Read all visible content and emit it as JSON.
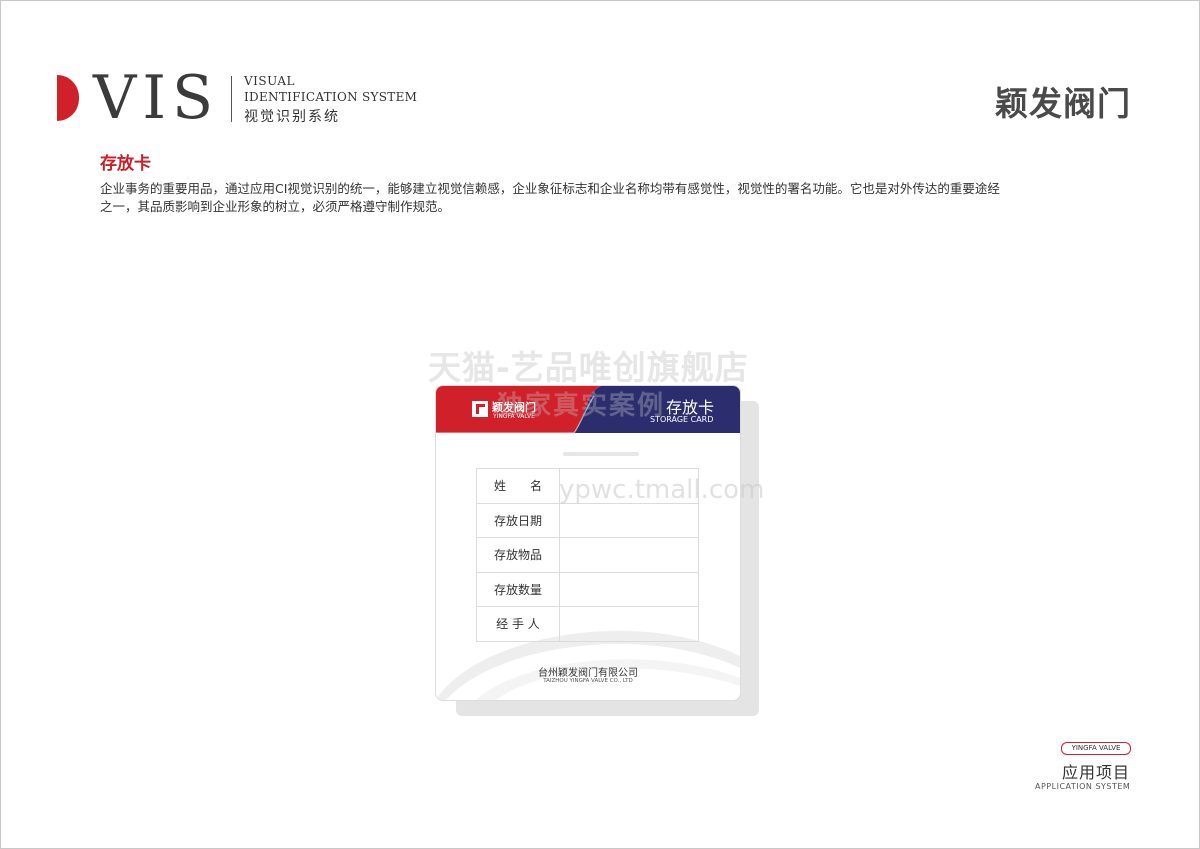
{
  "header": {
    "vis_word": "VIS",
    "line1": "VISUAL",
    "line2": "IDENTIFICATION SYSTEM",
    "line3": "视觉识别系统",
    "brand_right": "颖发阀门"
  },
  "section": {
    "title": "存放卡",
    "description": "企业事务的重要用品，通过应用CI视觉识别的统一，能够建立视觉信赖感，企业象征标志和企业名称均带有感觉性，视觉性的署名功能。它也是对外传达的重要途经之一，其品质影响到企业形象的树立，必须严格遵守制作规范。"
  },
  "watermark": {
    "line1": "天猫-艺品唯创旗舰店",
    "line2": "独家真实案例",
    "line3": "ypwc.tmall.com"
  },
  "card": {
    "logo_cn": "颖发阀门",
    "logo_en": "YINGFA VALVE",
    "title_cn": "存放卡",
    "title_en": "STORAGE CARD",
    "rows": [
      {
        "label": "姓　　名"
      },
      {
        "label": "存放日期"
      },
      {
        "label": "存放物品"
      },
      {
        "label": "存放数量"
      },
      {
        "label": "经 手 人"
      }
    ],
    "company_cn": "台州颖发阀门有限公司",
    "company_en": "TAIZHOU YINGFA VALVE CO., LTD",
    "colors": {
      "red": "#d0202a",
      "navy": "#2b2d6e"
    }
  },
  "footer": {
    "badge": "YINGFA VALVE",
    "cn": "应用项目",
    "en": "APPLICATION SYSTEM"
  }
}
